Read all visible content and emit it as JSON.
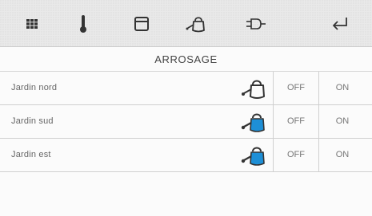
{
  "toolbar": {
    "icons": [
      "grid-icon",
      "thermometer-icon",
      "window-icon",
      "watering-can-icon",
      "plug-icon",
      "back-arrow-icon"
    ]
  },
  "page": {
    "title": "ARROSAGE"
  },
  "zones": [
    {
      "name": "Jardin nord",
      "icon": "watering-can-outline-icon",
      "active": false,
      "off_label": "OFF",
      "on_label": "ON"
    },
    {
      "name": "Jardin sud",
      "icon": "watering-can-blue-icon",
      "active": true,
      "off_label": "OFF",
      "on_label": "ON"
    },
    {
      "name": "Jardin est",
      "icon": "watering-can-blue-icon",
      "active": true,
      "off_label": "OFF",
      "on_label": "ON"
    }
  ],
  "colors": {
    "water_blue": "#1e8fd6",
    "icon_dark": "#333333",
    "toolbar_bg": "#e9e9e9"
  }
}
